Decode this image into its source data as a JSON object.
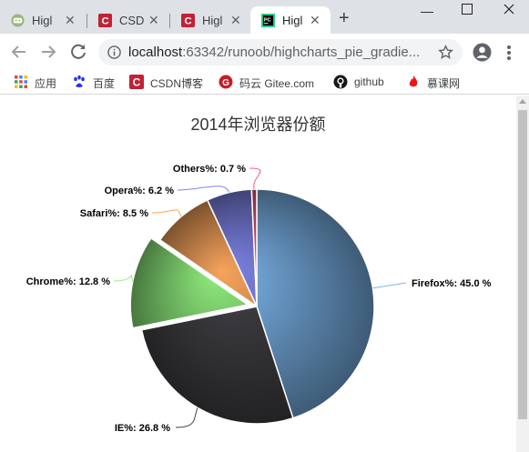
{
  "browser": {
    "tabs": [
      {
        "title": "Higl",
        "icon": "runoob-favicon"
      },
      {
        "title": "CSD",
        "icon": "csdn-favicon"
      },
      {
        "title": "Higl",
        "icon": "csdn-favicon"
      },
      {
        "title": "Higl",
        "icon": "pycharm-favicon"
      }
    ],
    "url_host": "localhost",
    "url_rest": ":63342/runoob/highcharts_pie_gradie...",
    "bookmarks": [
      {
        "label": "应用",
        "icon": "apps-grid-icon"
      },
      {
        "label": "百度",
        "icon": "baidu-paw-icon"
      },
      {
        "label": "CSDN博客",
        "icon": "csdn-icon"
      },
      {
        "label": "码云 Gitee.com",
        "icon": "gitee-icon"
      },
      {
        "label": "github",
        "icon": "github-icon"
      },
      {
        "label": "慕课网",
        "icon": "imooc-flame-icon"
      }
    ]
  },
  "chart_data": {
    "type": "pie",
    "title": "2014年浏览器份额",
    "series": [
      {
        "name": "Firefox",
        "value": 45.0,
        "label": "Firefox%: 45.0 %",
        "color": "#7cb5ec",
        "sliced": false
      },
      {
        "name": "IE",
        "value": 26.8,
        "label": "IE%: 26.8 %",
        "color": "#434348",
        "sliced": false
      },
      {
        "name": "Chrome",
        "value": 12.8,
        "label": "Chrome%: 12.8 %",
        "color": "#90ed7d",
        "sliced": true
      },
      {
        "name": "Safari",
        "value": 8.5,
        "label": "Safari%: 8.5 %",
        "color": "#f7a35c",
        "sliced": false
      },
      {
        "name": "Opera",
        "value": 6.2,
        "label": "Opera%: 6.2 %",
        "color": "#8085e9",
        "sliced": false
      },
      {
        "name": "Others",
        "value": 0.7,
        "label": "Others%: 0.7 %",
        "color": "#f15c80",
        "sliced": false
      }
    ]
  }
}
